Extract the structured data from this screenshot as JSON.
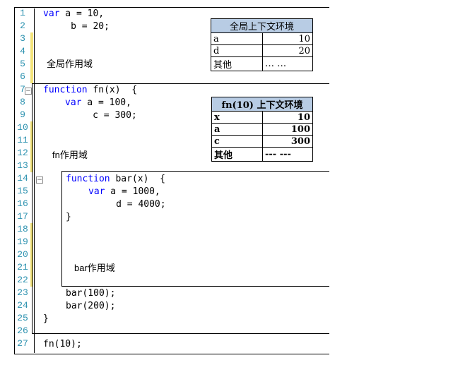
{
  "line_numbers": [
    "1",
    "2",
    "3",
    "4",
    "5",
    "6",
    "7",
    "8",
    "9",
    "10",
    "11",
    "12",
    "13",
    "14",
    "15",
    "16",
    "17",
    "18",
    "19",
    "20",
    "21",
    "22",
    "23",
    "24",
    "25",
    "26",
    "27"
  ],
  "code": {
    "l1_kw": "var",
    "l1_rest": " a = 10,",
    "l2": "     b = 20;",
    "l7_kw": "function",
    "l7_rest": " fn(x)  {",
    "l8_kw": "var",
    "l8_rest": " a = 100,",
    "l9": "     c = 300;",
    "l14_kw": "function",
    "l14_rest": " bar(x)  {",
    "l15_kw": "var",
    "l15_rest": " a = 1000,",
    "l16": "     d = 4000;",
    "l17": "}",
    "l23": "bar(100);",
    "l24": "bar(200);",
    "l25": "}",
    "l27": "fn(10);"
  },
  "scopes": {
    "global_label": "全局作用域",
    "fn_label": "fn作用域",
    "bar_label": "bar作用域"
  },
  "global_context": {
    "title": "全局上下文环境",
    "rows": [
      {
        "k": "a",
        "v": "10"
      },
      {
        "k": "d",
        "v": "20"
      },
      {
        "k": "其他",
        "v": "…  …"
      }
    ]
  },
  "fn_context": {
    "title": "fn(10) 上下文环境",
    "rows": [
      {
        "k": "x",
        "v": "10"
      },
      {
        "k": "a",
        "v": "100"
      },
      {
        "k": "c",
        "v": "300"
      },
      {
        "k": "其他",
        "v": "---  ---"
      }
    ]
  },
  "colors": {
    "keyword": "#0000ff",
    "line_number": "#2b91af",
    "header_fill": "#b8cce4",
    "change_bar": "#f4e47a"
  }
}
